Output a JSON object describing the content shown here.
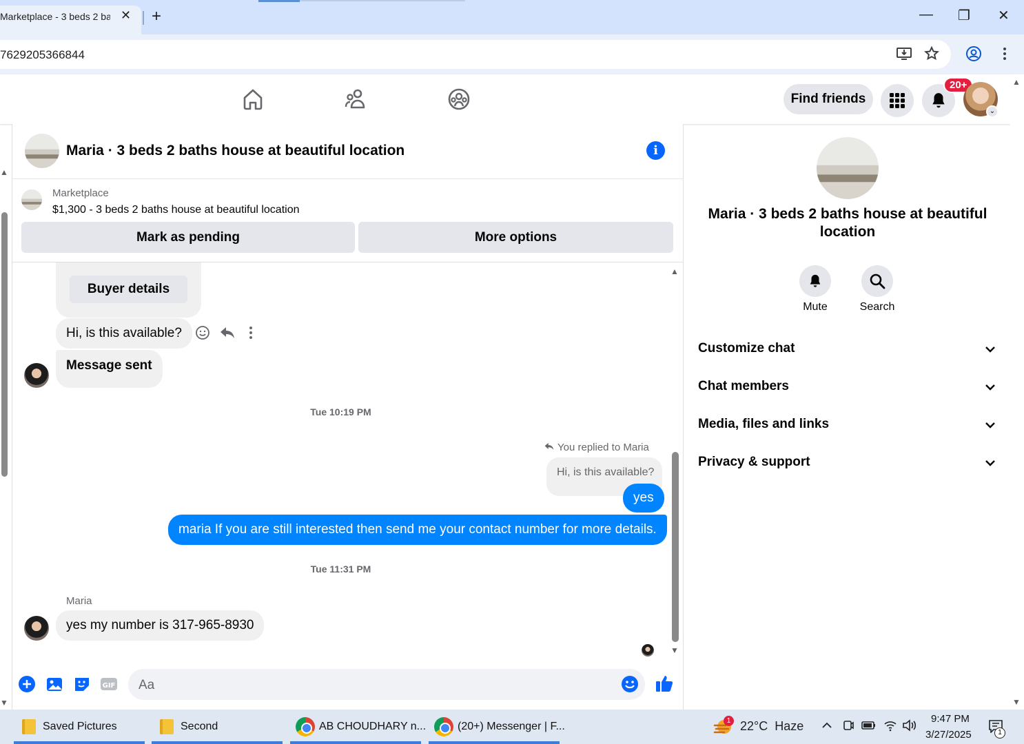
{
  "browser": {
    "tab_title": "Marketplace - 3 beds 2 ba",
    "url": "7629205366844",
    "minimize": "—",
    "maximize": "❐",
    "close": "✕"
  },
  "topbar": {
    "find_friends": "Find friends",
    "notification_count": "20+"
  },
  "chat": {
    "title": "Maria · 3 beds 2 baths house at beautiful location",
    "marketplace_label": "Marketplace",
    "listing": "$1,300 - 3 beds 2 baths house at beautiful location",
    "mark_pending": "Mark as pending",
    "more_options": "More options",
    "buyer_details": "Buyer details",
    "msg_available": "Hi, is this available?",
    "msg_sent": "Message sent",
    "ts1": "Tue 10:19 PM",
    "replied_label": "You replied to Maria",
    "quoted": "Hi, is this available?",
    "msg_yes": "yes",
    "msg_long": "maria If you are still interested then send me your contact number for more details.",
    "ts2": "Tue 11:31 PM",
    "sender_name": "Maria",
    "msg_number": "yes my number is 317-965-8930",
    "composer_placeholder": "Aa"
  },
  "details": {
    "title": "Maria · 3 beds 2 baths house at beautiful location",
    "mute": "Mute",
    "search": "Search",
    "sections": [
      "Customize chat",
      "Chat members",
      "Media, files and links",
      "Privacy & support"
    ]
  },
  "taskbar": {
    "items": [
      "Saved Pictures",
      "Second",
      "AB CHOUDHARY n...",
      "(20+) Messenger | F..."
    ],
    "weather": "22°C  Haze",
    "weather_badge": "1",
    "time": "9:47 PM",
    "date": "3/27/2025",
    "notif_count": "1"
  },
  "colors": {
    "accent": "#0866ff",
    "bubble_blue": "#0084ff",
    "badge_red": "#e41e3f"
  }
}
